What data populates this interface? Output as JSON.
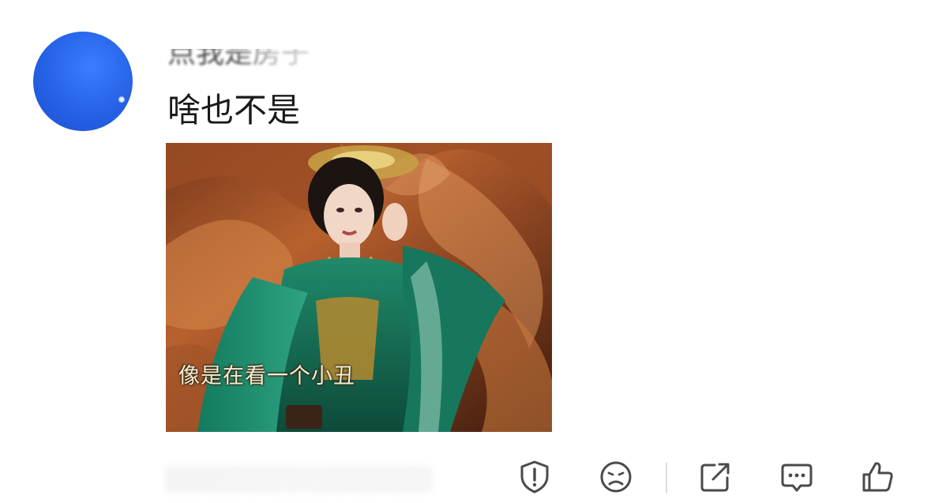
{
  "comment": {
    "username": "点我是房子",
    "text": "啥也不是",
    "time_text": "",
    "avatar_icon": "avatar-blue-planet",
    "media": {
      "subtitle": "像是在看一个小丑",
      "alt_kind": "meme-image"
    }
  },
  "actions": [
    {
      "name": "report-button",
      "icon": "shield-exclamation-icon"
    },
    {
      "name": "dislike-button",
      "icon": "frown-face-icon"
    },
    {
      "name": "share-button",
      "icon": "share-out-icon"
    },
    {
      "name": "reply-button",
      "icon": "comment-bubble-icon"
    },
    {
      "name": "like-button",
      "icon": "thumbs-up-icon"
    }
  ],
  "colors": {
    "avatar": "#2866ea",
    "icon_stroke": "#4a4a4a",
    "text": "#1a1a1a",
    "divider": "#dcdcdc"
  }
}
